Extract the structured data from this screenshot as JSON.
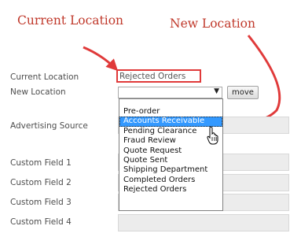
{
  "annotations": {
    "current_location": "Current Location",
    "new_location": "New Location",
    "color": "#c0392b"
  },
  "form": {
    "current_location_label": "Current Location",
    "current_location_value": "Rejected Orders",
    "new_location_label": "New Location",
    "move_button": "move",
    "advertising_source_label": "Advertising Source",
    "custom_field_1_label": "Custom Field 1",
    "custom_field_2_label": "Custom Field 2",
    "custom_field_3_label": "Custom Field 3",
    "custom_field_4_label": "Custom Field 4"
  },
  "dropdown": {
    "selected_index": 1,
    "options": [
      "Pre-order",
      "Accounts Receivable",
      "Pending Clearance",
      "Fraud Review",
      "Quote Request",
      "Quote Sent",
      "Shipping Department",
      "Completed Orders",
      "Rejected Orders"
    ]
  },
  "icons": {
    "select_arrow": "chevron-down-icon",
    "cursor": "hand-pointer-icon"
  }
}
